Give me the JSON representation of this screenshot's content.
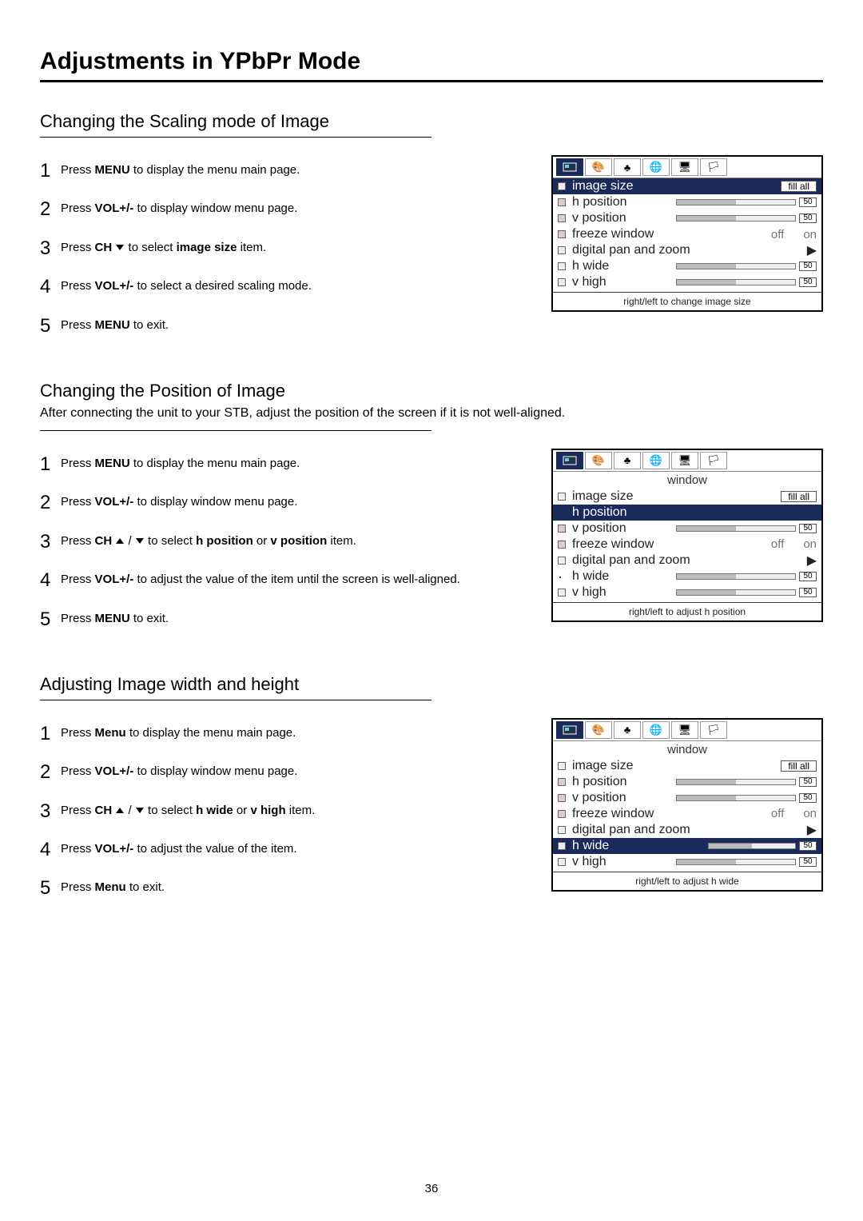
{
  "page_title": "Adjustments in YPbPr Mode",
  "page_number": "36",
  "sections": [
    {
      "title": "Changing the Scaling mode of Image",
      "desc": "",
      "steps": [
        "Press <b>MENU</b> to display the menu main page.",
        "Press <b>VOL+/-</b> to display window menu page.",
        "Press <b>CH</b> ▾ to select <b>image size</b> item.",
        "Press <b>VOL+/-</b> to select a desired scaling mode.",
        "Press <b>MENU</b> to exit."
      ],
      "osd": {
        "subtitle": "",
        "selected": "image size",
        "footer": "right/left to change image size"
      }
    },
    {
      "title": "Changing the Position of Image",
      "desc": "After connecting the unit to your STB, adjust the position of the screen if it is not well-aligned.",
      "steps": [
        "Press <b>MENU</b> to display the menu main page.",
        "Press <b>VOL+/-</b> to display window menu page.",
        "Press <b>CH</b> ▴ / ▾ to select <b>h position</b> or <b>v position</b> item.",
        "Press <b>VOL+/-</b> to adjust the value of the item until the screen is well-aligned.",
        "Press <b>MENU</b> to exit."
      ],
      "osd": {
        "subtitle": "window",
        "selected": "h position",
        "footer": "right/left to adjust h position"
      }
    },
    {
      "title": "Adjusting Image width and height",
      "desc": "",
      "steps": [
        "Press <b>Menu</b> to display the menu main page.",
        "Press <b>VOL+/-</b> to display window menu page.",
        "Press <b>CH</b> ▴ / ▾ to select <b>h wide</b> or <b>v high</b> item.",
        "Press <b>VOL+/-</b> to adjust the value of the item.",
        "Press <b>Menu</b> to exit."
      ],
      "osd": {
        "subtitle": "window",
        "selected": "h wide",
        "footer": "right/left to adjust h wide"
      }
    }
  ],
  "osd_common": {
    "items": {
      "image_size": "image size",
      "h_position": "h position",
      "v_position": "v position",
      "freeze_window": "freeze window",
      "digital_pan": "digital pan and zoom",
      "h_wide": "h wide",
      "v_high": "v high"
    },
    "fill_all": "fill all",
    "off": "off",
    "on": "on",
    "val50": "50"
  }
}
